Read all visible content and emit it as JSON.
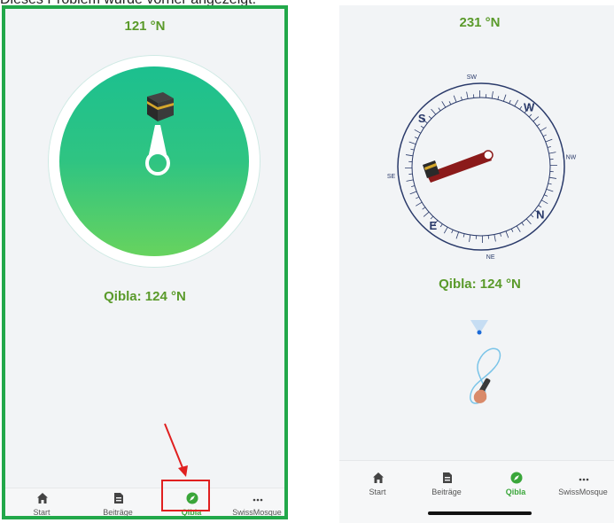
{
  "caption": "Dieses Problem wurde vorher angezeigt:",
  "left_phone": {
    "heading": "121 °N",
    "qibla": "Qibla: 124 °N",
    "nav": [
      {
        "label": "Start",
        "icon": "home-icon"
      },
      {
        "label": "Beiträge",
        "icon": "document-icon"
      },
      {
        "label": "Qibla",
        "icon": "compass-icon",
        "active": true
      },
      {
        "label": "SwissMosque",
        "icon": "more-icon"
      }
    ]
  },
  "right_phone": {
    "heading": "231 °N",
    "qibla": "Qibla: 124 °N",
    "dial": {
      "cardinals": {
        "n": "N",
        "e": "E",
        "s": "S",
        "w": "W"
      },
      "intercardinals": {
        "sw": "SW",
        "nw": "NW",
        "se": "SE",
        "ne": "NE"
      }
    },
    "nav": [
      {
        "label": "Start",
        "icon": "home-icon"
      },
      {
        "label": "Beiträge",
        "icon": "document-icon"
      },
      {
        "label": "Qibla",
        "icon": "compass-icon",
        "active": true
      },
      {
        "label": "SwissMosque",
        "icon": "more-icon"
      }
    ]
  },
  "colors": {
    "frame_green": "#22a84a",
    "accent_green": "#5a9a2a",
    "highlight_red": "#e02020",
    "needle_dark_red": "#8b1a1a"
  }
}
